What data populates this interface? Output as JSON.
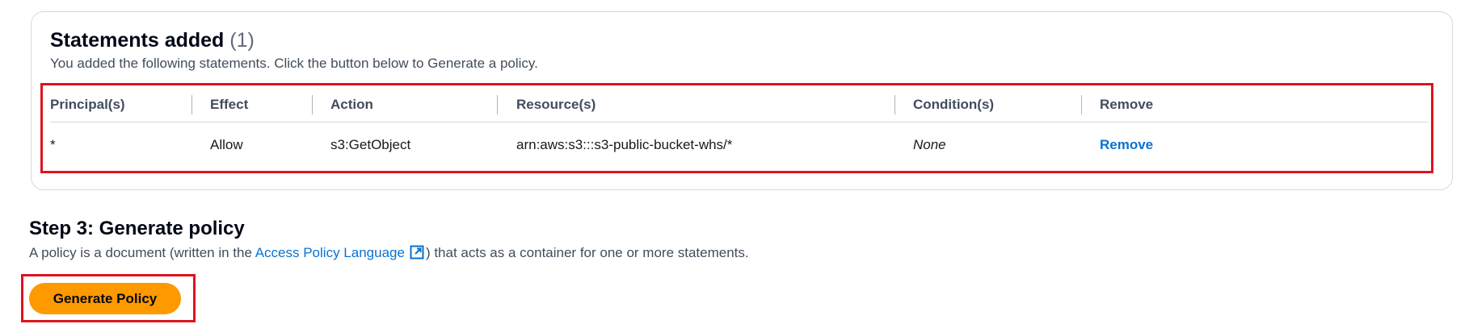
{
  "statements": {
    "title": "Statements added",
    "count": "(1)",
    "description": "You added the following statements. Click the button below to Generate a policy.",
    "columns": [
      "Principal(s)",
      "Effect",
      "Action",
      "Resource(s)",
      "Condition(s)",
      "Remove"
    ],
    "rows": [
      {
        "principal": "*",
        "effect": "Allow",
        "action": "s3:GetObject",
        "resource": "arn:aws:s3:::s3-public-bucket-whs/*",
        "condition": "None",
        "remove": "Remove"
      }
    ]
  },
  "step3": {
    "title": "Step 3: Generate policy",
    "desc_before": "A policy is a document (written in the ",
    "link_text": "Access Policy Language",
    "desc_after": ") that acts as a container for one or more statements.",
    "button_label": "Generate Policy"
  },
  "colors": {
    "highlight": "#e0121f",
    "link": "#0972d3",
    "primary_button": "#ff9900"
  }
}
